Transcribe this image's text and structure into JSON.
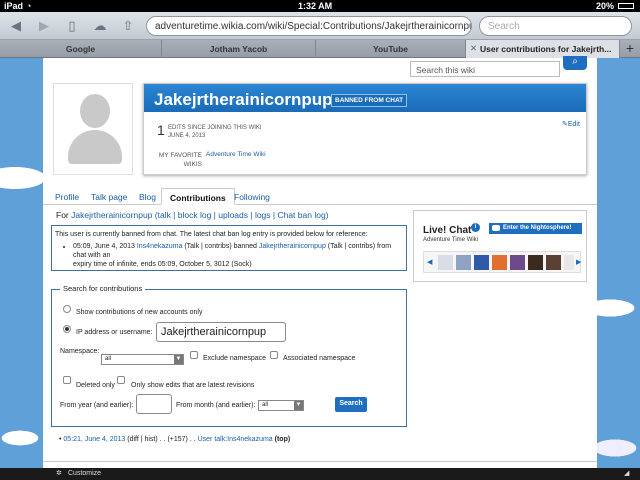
{
  "status_bar": {
    "device": "iPad",
    "time": "1:32 AM",
    "battery": "20%"
  },
  "browser": {
    "url": "adventuretime.wikia.com/wiki/Special:Contributions/Jakejrtherainicornpup",
    "search_placeholder": "Search",
    "tabs": [
      {
        "label": "Google"
      },
      {
        "label": "Jotham Yacob"
      },
      {
        "label": "YouTube"
      },
      {
        "label": "User contributions for Jakejrth..."
      }
    ],
    "new_tab": "+"
  },
  "wiki": {
    "search_placeholder": "Search this wiki"
  },
  "profile": {
    "username": "Jakejrtherainicornpup",
    "banned_badge": "BANNED FROM CHAT",
    "edit_count": "1",
    "edits_label_1": "EDITS SINCE JOINING THIS WIKI",
    "edits_label_2": "JUNE 4, 2013",
    "favorite_label": "MY FAVORITE WIKIS",
    "favorite_value": "Adventure Time Wiki",
    "edit_link": "Edit"
  },
  "profile_tabs": [
    {
      "label": "Profile"
    },
    {
      "label": "Talk page"
    },
    {
      "label": "Blog"
    },
    {
      "label": "Contributions"
    },
    {
      "label": "Following"
    }
  ],
  "for_line": {
    "prefix": "For ",
    "user": "Jakejrtherainicornpup",
    "links": " (talk | block log | uploads | logs | Chat ban log)"
  },
  "ban_notice": {
    "text": "This user is currently banned from chat. The latest chat ban log entry is provided below for reference:",
    "entry_date": "05:09, June 4, 2013",
    "entry_actor": "Ins4nekazuma",
    "entry_actor_links": " (Talk | contribs) banned ",
    "entry_target": "Jakejrtherainicornpup",
    "entry_target_links": " (Talk | contribs) from chat with an",
    "entry_line2": "expiry time of infinite, ends 05:09, October 5, 3012 (Sock)"
  },
  "chat": {
    "title": "Live! Chat",
    "button": "Enter the Nightosphere!",
    "subtitle": "Adventure Time Wiki",
    "thumb_colors": [
      "#d9dde6",
      "#8fa2c2",
      "#2f5aa8",
      "#e07030",
      "#6d4a8c",
      "#3b2a1e",
      "#5a4030",
      "#e8e8e8"
    ]
  },
  "search_form": {
    "legend": "Search for contributions",
    "opt_new": "Show contributions of new accounts only",
    "opt_ip": "IP address or username:",
    "username_value": "Jakejrtherainicornpup",
    "namespace_label": "Namespace:",
    "namespace_value": "all",
    "exclude_label": "Exclude namespace",
    "associated_label": "Associated namespace",
    "deleted_label": "Deleted only",
    "latest_label": "Only show edits that are latest revisions",
    "year_label": "From year (and earlier):",
    "month_label": "From month (and earlier):",
    "month_value": "all",
    "search_button": "Search"
  },
  "result": {
    "date": "05:21, June 4, 2013",
    "links": " (diff | hist) . . (+157) . . ",
    "page": "User talk:Ins4nekazuma",
    "top": " (top)"
  },
  "bottom_bar": {
    "label": "Customize"
  }
}
